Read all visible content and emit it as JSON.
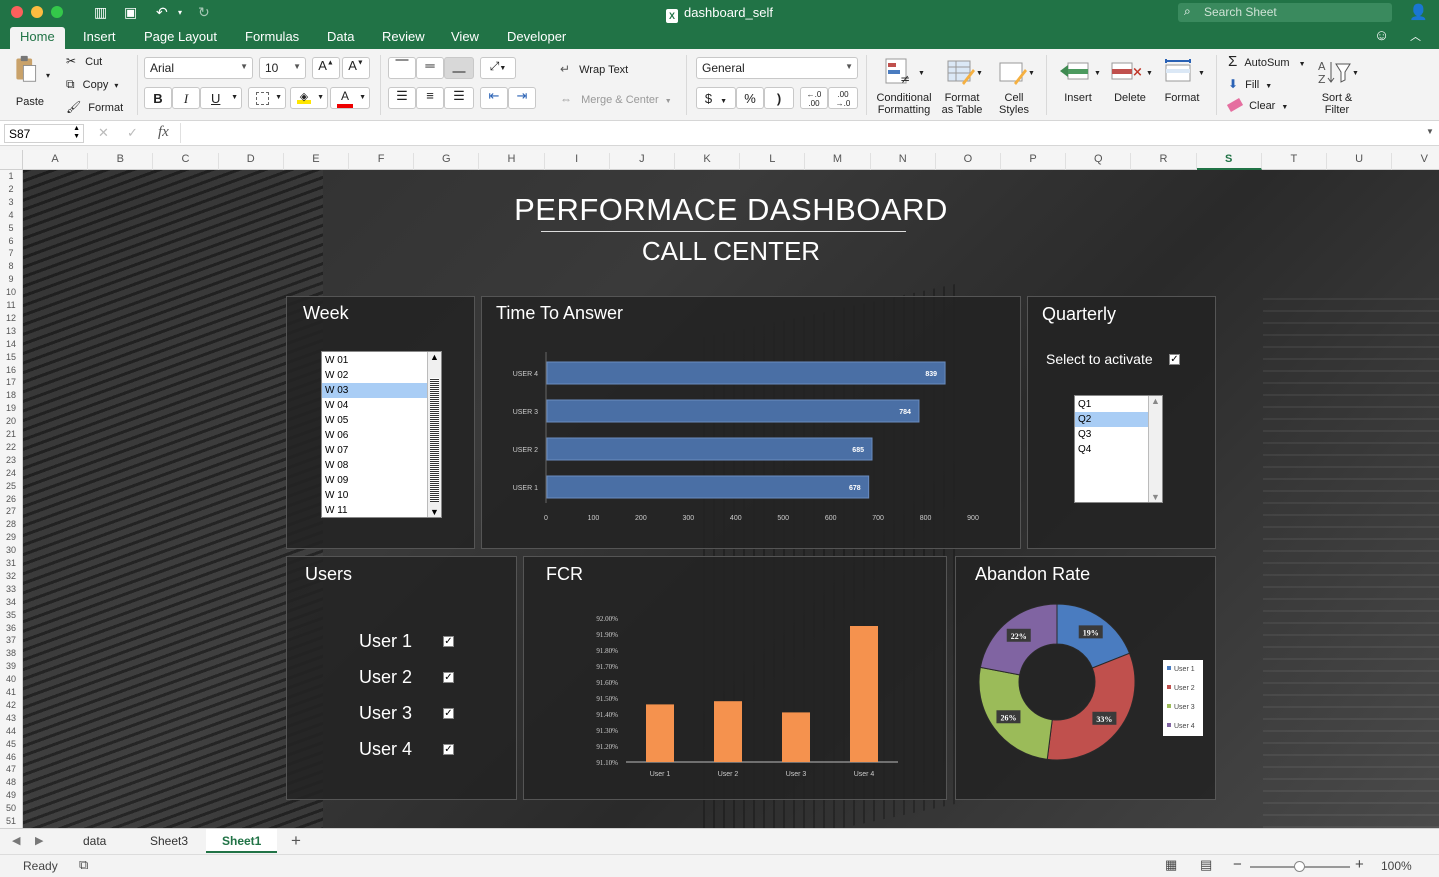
{
  "window": {
    "title": "dashboard_self",
    "search_placeholder": "Search Sheet"
  },
  "tabs": [
    "Home",
    "Insert",
    "Page Layout",
    "Formulas",
    "Data",
    "Review",
    "View",
    "Developer"
  ],
  "ribbon": {
    "paste": "Paste",
    "cut": "Cut",
    "copy": "Copy",
    "format_painter": "Format",
    "font_name": "Arial",
    "font_size": "10",
    "bold": "B",
    "italic": "I",
    "underline": "U",
    "wrap_text": "Wrap Text",
    "merge_center": "Merge & Center",
    "number_format": "General",
    "currency": "$",
    "percent": "%",
    "comma": ")",
    "conditional_formatting": "Conditional Formatting",
    "format_as_table": "Format as Table",
    "cell_styles": "Cell Styles",
    "insert": "Insert",
    "delete": "Delete",
    "format": "Format",
    "autosum": "AutoSum",
    "fill": "Fill",
    "clear": "Clear",
    "sort_filter": "Sort & Filter"
  },
  "formula_bar": {
    "name_box": "S87",
    "fx": "fx",
    "value": ""
  },
  "columns": [
    "A",
    "B",
    "C",
    "D",
    "E",
    "F",
    "G",
    "H",
    "I",
    "J",
    "K",
    "L",
    "M",
    "N",
    "O",
    "P",
    "Q",
    "R",
    "S",
    "T",
    "U",
    "V"
  ],
  "selected_column": "S",
  "rows_visible": 51,
  "dashboard": {
    "title": "PERFORMACE DASHBOARD",
    "subtitle": "CALL CENTER",
    "week_panel": {
      "title": "Week",
      "items": [
        "W 01",
        "W 02",
        "W 03",
        "W 04",
        "W 05",
        "W 06",
        "W 07",
        "W 08",
        "W 09",
        "W 10",
        "W 11"
      ],
      "selected": "W 03"
    },
    "quarterly_panel": {
      "title": "Quarterly",
      "activate_label": "Select to activate",
      "activate_checked": true,
      "items": [
        "Q1",
        "Q2",
        "Q3",
        "Q4"
      ],
      "selected": "Q2"
    },
    "users_panel": {
      "title": "Users",
      "users": [
        {
          "label": "User 1",
          "checked": true
        },
        {
          "label": "User 2",
          "checked": true
        },
        {
          "label": "User 3",
          "checked": true
        },
        {
          "label": "User 4",
          "checked": true
        }
      ]
    }
  },
  "chart_data": [
    {
      "type": "bar",
      "orientation": "horizontal",
      "title": "Time To Answer",
      "categories": [
        "USER 4",
        "USER 3",
        "USER 2",
        "USER 1"
      ],
      "values": [
        839,
        784,
        685,
        678
      ],
      "xlim": [
        0,
        900
      ],
      "xticks": [
        0,
        100,
        200,
        300,
        400,
        500,
        600,
        700,
        800,
        900
      ],
      "color": "#4a6fa5"
    },
    {
      "type": "bar",
      "title": "FCR",
      "categories": [
        "User 1",
        "User 2",
        "User 3",
        "User 4"
      ],
      "values": [
        91.46,
        91.48,
        91.41,
        91.95
      ],
      "ylim": [
        91.1,
        92.0
      ],
      "yticks": [
        "92.00%",
        "91.90%",
        "91.80%",
        "91.70%",
        "91.60%",
        "91.50%",
        "91.40%",
        "91.30%",
        "91.20%",
        "91.10%"
      ],
      "color": "#f5924e"
    },
    {
      "type": "pie",
      "style": "donut",
      "title": "Abandon Rate",
      "categories": [
        "User 1",
        "User 2",
        "User 3",
        "User 4"
      ],
      "values": [
        19,
        33,
        26,
        22
      ],
      "labels": [
        "19%",
        "33%",
        "26%",
        "22%"
      ],
      "colors": [
        "#4a7cc0",
        "#c0504d",
        "#9bbb59",
        "#8064a2"
      ],
      "legend": "right"
    }
  ],
  "sheet_tabs": [
    "data",
    "Sheet3",
    "Sheet1"
  ],
  "active_sheet": "Sheet1",
  "status": {
    "ready": "Ready",
    "zoom": "100%"
  }
}
